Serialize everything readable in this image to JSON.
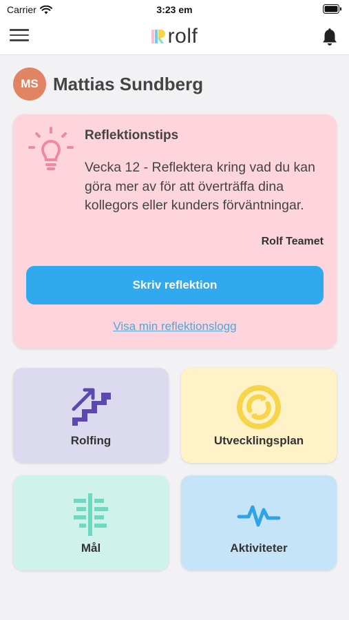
{
  "status_bar": {
    "carrier": "Carrier",
    "time": "3:23 em"
  },
  "nav": {
    "logo_text": "rolf",
    "menu_icon": "hamburger-menu-icon",
    "bell_icon": "bell-icon"
  },
  "user": {
    "initials": "MS",
    "name": "Mattias Sundberg",
    "avatar_color": "#e08463"
  },
  "tip": {
    "icon": "lightbulb-icon",
    "title": "Reflektionstips",
    "text": "Vecka 12 - Reflektera kring vad du kan göra mer av för att överträffa dina kollegors eller kunders förväntningar.",
    "author": "Rolf Teamet",
    "button_label": "Skriv reflektion",
    "link_label": "Visa min reflektionslogg",
    "bg_color": "#fed5dd",
    "button_color": "#31a9ef"
  },
  "tiles": [
    {
      "label": "Rolfing",
      "icon": "stairs-icon",
      "bg_color": "#dcdaef",
      "icon_color": "#5c48b0"
    },
    {
      "label": "Utvecklingsplan",
      "icon": "cycle-icon",
      "bg_color": "#fff2c6",
      "icon_color": "#f7d54a"
    },
    {
      "label": "Mål",
      "icon": "goal-tree-icon",
      "bg_color": "#cff2ea",
      "icon_color": "#6fd8c0"
    },
    {
      "label": "Aktiviteter",
      "icon": "pulse-icon",
      "bg_color": "#c5e4f8",
      "icon_color": "#2fa3e6"
    }
  ]
}
